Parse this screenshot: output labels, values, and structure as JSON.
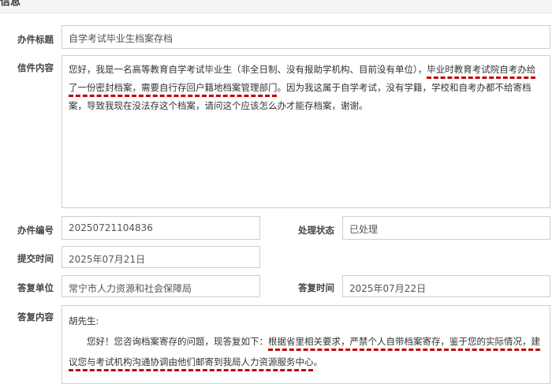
{
  "section_title": "信息",
  "fields": {
    "subject": {
      "label": "办件标题",
      "value": "自学考试毕业生档案存档"
    },
    "content": {
      "label": "信件内容",
      "seg1": "您好，我是一名高等教育自学考试毕业生（非全日制、没有报助学机构、目前没有单位），",
      "seg2": "毕业时教育考试院自考办给了一份密封档案，需要自行存回户籍地档案管理部门",
      "seg3": "。因为我这属于自学考试，没有学籍，学校和自考办都不给寄档案，导致我现在没法存这个档案，请问这个应该怎么办才能存档案，谢谢。"
    },
    "case_number": {
      "label": "办件编号",
      "value": "20250721104836"
    },
    "status": {
      "label": "处理状态",
      "value": "已处理"
    },
    "submit_time": {
      "label": "提交时间",
      "value": "2025年07月21日"
    },
    "reply_unit": {
      "label": "答复单位",
      "value": "常宁市人力资源和社会保障局"
    },
    "reply_time": {
      "label": "答复时间",
      "value": "2025年07月22日"
    },
    "reply_content": {
      "label": "答复内容",
      "greeting": "胡先生:",
      "seg1": "您好！您咨询档案寄存的问题，现答复如下：",
      "seg2": "根据省里相关要求，严禁个人自带档案寄存，鉴于您的实际情况，建议您与考试机构沟通协调由他们邮寄到我局人力资源服务中心",
      "seg3": "。"
    }
  }
}
